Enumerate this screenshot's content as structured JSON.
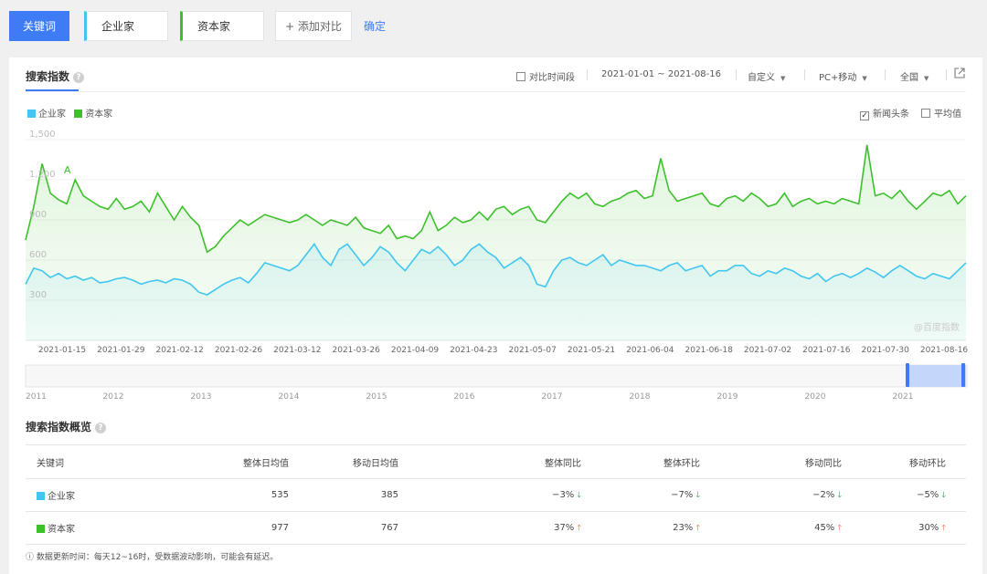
{
  "top": {
    "active_keyword": "关键词",
    "keywords": [
      "企业家",
      "资本家"
    ],
    "add_label": "+ 添加对比",
    "confirm_label": "确定"
  },
  "panel": {
    "title": "搜索指数",
    "compare_period": "对比时间段",
    "date_range": "2021-01-01 ~ 2021-08-16",
    "custom": "自定义",
    "device": "PC+移动",
    "region": "全国",
    "news": "新闻头条",
    "average": "平均值",
    "watermark": "@百度指数"
  },
  "colors": {
    "series1": "#41c6f1",
    "series2": "#3cc12b",
    "accent": "#3d7cf4"
  },
  "chart_data": {
    "type": "line",
    "ylim": [
      0,
      1500
    ],
    "yticks": [
      "1,500",
      "1,200",
      "900",
      "600",
      "300"
    ],
    "xticks": [
      "2021-01-15",
      "2021-01-29",
      "2021-02-12",
      "2021-02-26",
      "2021-03-12",
      "2021-03-26",
      "2021-04-09",
      "2021-04-23",
      "2021-05-07",
      "2021-05-21",
      "2021-06-04",
      "2021-06-18",
      "2021-07-02",
      "2021-07-16",
      "2021-07-30",
      "2021-08-16"
    ],
    "annotation": "A",
    "series": [
      {
        "name": "企业家",
        "values": [
          420,
          540,
          520,
          470,
          500,
          460,
          480,
          450,
          470,
          430,
          440,
          460,
          470,
          450,
          420,
          440,
          450,
          430,
          460,
          450,
          420,
          360,
          340,
          380,
          420,
          450,
          470,
          430,
          500,
          580,
          560,
          540,
          520,
          560,
          640,
          720,
          620,
          560,
          680,
          720,
          640,
          560,
          620,
          700,
          660,
          580,
          520,
          600,
          680,
          650,
          700,
          640,
          560,
          600,
          680,
          720,
          660,
          620,
          540,
          580,
          620,
          560,
          420,
          400,
          520,
          600,
          620,
          580,
          560,
          600,
          640,
          560,
          600,
          580,
          560,
          560,
          540,
          520,
          560,
          580,
          520,
          540,
          560,
          480,
          520,
          520,
          560,
          560,
          500,
          480,
          520,
          500,
          540,
          520,
          480,
          460,
          500,
          440,
          480,
          500,
          470,
          500,
          540,
          510,
          470,
          520,
          560,
          520,
          480,
          460,
          500,
          480,
          460,
          520,
          580
        ]
      },
      {
        "name": "资本家",
        "values": [
          750,
          1000,
          1320,
          1100,
          1050,
          1020,
          1200,
          1080,
          1040,
          1000,
          980,
          1060,
          980,
          1000,
          1040,
          960,
          1100,
          1000,
          900,
          1000,
          920,
          860,
          660,
          700,
          780,
          840,
          900,
          860,
          900,
          940,
          920,
          900,
          880,
          900,
          940,
          900,
          860,
          900,
          880,
          860,
          920,
          840,
          820,
          800,
          860,
          760,
          780,
          760,
          820,
          960,
          820,
          860,
          920,
          880,
          900,
          960,
          900,
          980,
          1000,
          940,
          980,
          1000,
          900,
          880,
          960,
          1040,
          1100,
          1060,
          1100,
          1020,
          1000,
          1040,
          1060,
          1100,
          1120,
          1060,
          1080,
          1360,
          1120,
          1040,
          1060,
          1080,
          1100,
          1020,
          1000,
          1060,
          1080,
          1040,
          1100,
          1060,
          1000,
          1020,
          1100,
          1000,
          1040,
          1060,
          1020,
          1040,
          1020,
          1060,
          1040,
          1020,
          1460,
          1080,
          1100,
          1060,
          1120,
          1040,
          980,
          1040,
          1100,
          1080,
          1120,
          1020,
          1080
        ]
      }
    ],
    "overview_years": [
      "2011",
      "2012",
      "2013",
      "2014",
      "2015",
      "2016",
      "2017",
      "2018",
      "2019",
      "2020",
      "2021"
    ]
  },
  "summary": {
    "title": "搜索指数概览",
    "headers": [
      "关键词",
      "整体日均值",
      "移动日均值",
      "整体同比",
      "整体环比",
      "移动同比",
      "移动环比"
    ],
    "rows": [
      {
        "keyword": "企业家",
        "overall_avg": "535",
        "mobile_avg": "385",
        "overall_yoy": "−3%",
        "overall_mom": "−7%",
        "mobile_yoy": "−2%",
        "mobile_mom": "−5%",
        "trend": [
          "down",
          "down",
          "down",
          "down"
        ]
      },
      {
        "keyword": "资本家",
        "overall_avg": "977",
        "mobile_avg": "767",
        "overall_yoy": "37%",
        "overall_mom": "23%",
        "mobile_yoy": "45%",
        "mobile_mom": "30%",
        "trend": [
          "up",
          "up",
          "up",
          "up"
        ]
      }
    ],
    "note": "ⓘ 数据更新时间：每天12~16时，受数据波动影响，可能会有延迟。"
  }
}
